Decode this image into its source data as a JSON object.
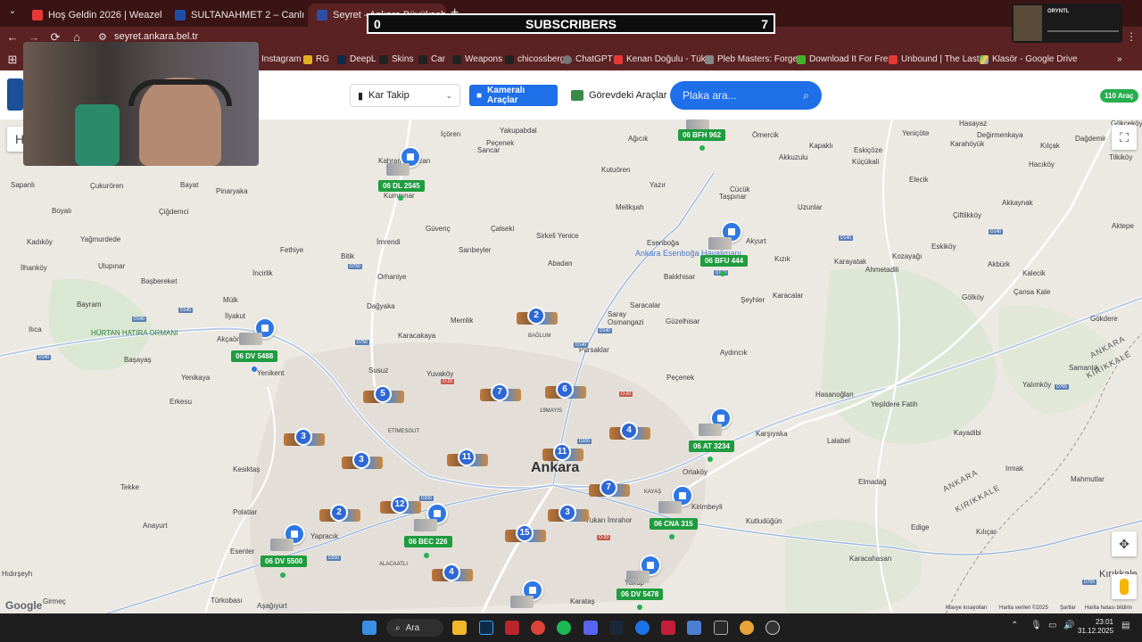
{
  "browser": {
    "tabs": [
      {
        "title": "Hoş Geldin 2026 | Weazel Medi",
        "active": false
      },
      {
        "title": "SULTANAHMET 2 – Canlı Kame",
        "active": false
      },
      {
        "title": "Seyret - Ankara Büyükşehir Bel",
        "active": true
      }
    ],
    "url": "seyret.ankara.bel.tr",
    "bookmarks": [
      "Instagram",
      "RG",
      "DeepL",
      "Skins",
      "Car",
      "Weapons",
      "chicossberg",
      "ChatGPT",
      "Kenan Doğulu - Tük...",
      "Pleb Masters: Forge...",
      "Download It For Fre...",
      "Unbound | The Last...",
      "Klasör - Google Drive"
    ]
  },
  "overlay": {
    "subs_left": "0",
    "subs_label": "SUBSCRIBERS",
    "subs_right": "7",
    "mini_player_label": "ORYNTL"
  },
  "app": {
    "dropdown_label": "Kar Takip",
    "camera_button": "Kameralı Araçlar",
    "duty_button": "Görevdeki Araçlar",
    "search_placeholder": "Plaka ara...",
    "vehicle_count": "110 Araç"
  },
  "map": {
    "city_label": "Ankara",
    "plates": [
      "06 BFH 962",
      "06 DL 2545",
      "06 BFU 444",
      "06 DV 5488",
      "06 AT 3234",
      "06 CNA 315",
      "06 BEC 226",
      "06 DV 5500",
      "06 DV 5478"
    ],
    "clusters": [
      "2",
      "5",
      "7",
      "6",
      "3",
      "3",
      "11",
      "11",
      "4",
      "7",
      "2",
      "12",
      "3",
      "15",
      "4"
    ],
    "places": {
      "icoren": "İçören",
      "yakupabdal": "Yakupabdal",
      "pecenek": "Peçenek",
      "sancar": "Sancar",
      "kahramankazan": "Kahramankazan",
      "kumpinar": "Kumpınar",
      "agicik": "Ağıcık",
      "omercik": "Ömercik",
      "hasayaz": "Hasayaz",
      "kapakli": "Kapaklı",
      "eskicoze": "Eskiçöze",
      "yenicoze": "Yeniçöte",
      "degirmenkaya": "Değirmenkaya",
      "kilcak": "Kılçak",
      "dagdemir": "Dağdemir",
      "gokcekoy": "Gökçeköy",
      "tilkikoy": "Tilkiköy",
      "sapanli": "Sapanlı",
      "cukuroren": "Çukurören",
      "bayat": "Bayat",
      "pinaryaka": "Pinaryaka",
      "boyali": "Boyalı",
      "ciglemci": "Çiğdemci",
      "kadikoy": "Kadıköy",
      "yagmurdede": "Yağmurdede",
      "ulupinar": "Ulupınar",
      "ilhankoy": "İlhanköy",
      "basbereket": "Başbereket",
      "bayram": "Bayram",
      "ilica": "Ilıca",
      "mulk": "Mülk",
      "ilyakut": "İlyakut",
      "akcaoren": "Akçaören",
      "basayas": "Başayaş",
      "yenikent": "Yenikent",
      "yenikaya": "Yenikaya",
      "erkesu": "Erkesu",
      "kesiktas": "Kesiktaş",
      "tekke": "Tekke",
      "anayurt": "Anayurt",
      "polatlar": "Polatlar",
      "esenler": "Esenler",
      "hidirseyh": "Hıdırşeyh",
      "girmec": "Girmeç",
      "turkobasi": "Türkobası",
      "asagiyurt": "Aşağıyurt",
      "hurtan": "HÜRTAN HATIRA ORMANI",
      "kutuoren": "Kutuören",
      "yazir": "Yazır",
      "melikşah": "Melikşah",
      "cucuk": "Cücük",
      "taspınar": "Taşpınar",
      "akkuzulu": "Akkuzulu",
      "uzunlar": "Uzunlar",
      "elecik": "Elecik",
      "kuculali": "Küçükali",
      "karahoyuk": "Karahöyük",
      "haciko": "Hacıköy",
      "ciftlikkoy": "Çiftlikköy",
      "akkaynak": "Akkaynak",
      "aktepe": "Aktepe",
      "guvenc": "Güvenç",
      "calseki": "Çalseki",
      "saribeyler": "Sarıbeyler",
      "sirkeli": "Sirkeli Yenice",
      "esenboga": "Esenboğa",
      "airport": "Ankara Esenboğa Havalimanı",
      "akyurt": "Akyurt",
      "kizik": "Kızık",
      "karayatak": "Karayatak",
      "ahmetadili": "Ahmetadili",
      "kozayagi": "Kozayağı",
      "eskikoy": "Eskiköy",
      "akburk": "Akbürk",
      "kalecik": "Kalecik",
      "cansakale": "Çansa Kale",
      "golkoy": "Gölköy",
      "gokdere": "Gökdere",
      "fethiye": "Fethiye",
      "bitik": "Bitik",
      "imrendi": "İmrendi",
      "orhaniye": "Orhaniye",
      "abadan": "Abadan",
      "balikhisar": "Balıkhisar",
      "seyhler": "Şeyhler",
      "karacalar": "Karacalar",
      "incirlik": "İncirlik",
      "dagoke": "Dağyaka",
      "karacakaya": "Karacakaya",
      "memlik": "Memlik",
      "saray": "Saray",
      "osmangazi": "Osmangazi",
      "saracalar": "Saracalar",
      "guzelhisar": "Güzelhisar",
      "baglum": "BAĞLUM",
      "pursaklar": "Pursaklar",
      "aydinci": "Aydıncık",
      "susuz": "Susuz",
      "yuvakoy": "Yuvaköy",
      "samanlik": "Samanlık",
      "etimesgut": "ETİMESGUT",
      "mayis19": "19MAYIS",
      "pecenek2": "Peçenek",
      "hasanoglan": "Hasanoğlan",
      "yesildere": "Yeşildere Fatih",
      "karsiyaka": "Karşıyaka",
      "lalabel": "Lalabel",
      "kayadibi": "Kayadibi",
      "yalimkoy": "Yalımköy",
      "irmak": "Irmak",
      "mahmutlar": "Mahmutlar",
      "elmadag": "Elmadağ",
      "ortakoy": "Ortaköy",
      "kayas": "KAYAŞ",
      "kirimbeyli": "Kirimbeyli",
      "kutludugun": "Kutludüğün",
      "edige": "Edige",
      "kilicar": "Kılıçar",
      "karacahasan": "Karacahasan",
      "kirikkale": "Kırıkkale",
      "yapracik": "Yapracık",
      "alacatli": "ALACAATLI",
      "yukariimrahor": "Yukarı İmrahor",
      "karatas": "Karataş",
      "yakup": "Yakup",
      "prov1": "ANKARA",
      "prov2": "KIRIKKALE",
      "prov3": "ANKARA",
      "prov4": "KIRIKKALE"
    },
    "attribution": [
      "Klavye kısayolları",
      "Harita verileri ©2025",
      "Şartlar",
      "Harita hatası bildirin"
    ]
  },
  "taskbar": {
    "search": "Ara",
    "time": "23:01",
    "date": "31.12.2025"
  },
  "colors": {
    "accent": "#1e6fe8",
    "plate_green": "#1f9c3f",
    "tab_bg": "#3a1414"
  }
}
